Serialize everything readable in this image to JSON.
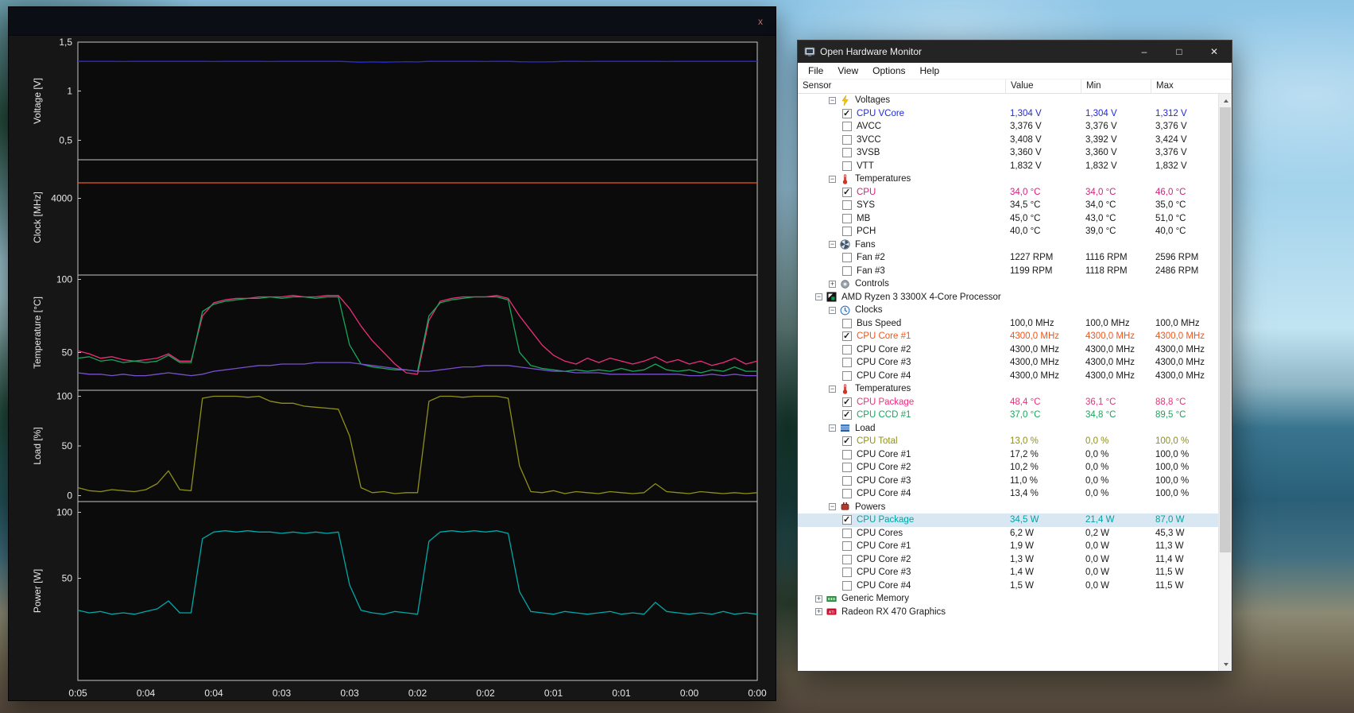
{
  "plot_window": {
    "close_label": "x",
    "x_axis": {
      "labels": [
        "0:05",
        "0:04",
        "0:04",
        "0:03",
        "0:03",
        "0:02",
        "0:02",
        "0:01",
        "0:01",
        "0:00",
        "0:00"
      ],
      "duration_s": 300,
      "step_s": 5
    },
    "colors": {
      "background": "#161616",
      "panel": "#0b0b0b",
      "border": "#c6c6c6",
      "text": "#e8e8e8"
    }
  },
  "chart_data": [
    {
      "type": "line",
      "ylabel": "Voltage [V]",
      "ymin": 0.3,
      "ymax": 1.5,
      "yticks": [
        {
          "value": 1.5,
          "label": "1,5"
        },
        {
          "value": 1.0,
          "label": "1"
        },
        {
          "value": 0.5,
          "label": "0,5"
        }
      ],
      "series": [
        {
          "name": "CPU VCore",
          "color": "#2a2ae0",
          "values": [
            1.304,
            1.304,
            1.304,
            1.304,
            1.302,
            1.304,
            1.304,
            1.304,
            1.304,
            1.304,
            1.304,
            1.304,
            1.302,
            1.304,
            1.304,
            1.304,
            1.304,
            1.302,
            1.304,
            1.304,
            1.304,
            1.304,
            1.304,
            1.304,
            1.3,
            1.296,
            1.298,
            1.296,
            1.298,
            1.3,
            1.298,
            1.304,
            1.304,
            1.304,
            1.304,
            1.304,
            1.302,
            1.304,
            1.304,
            1.3,
            1.298,
            1.298,
            1.3,
            1.304,
            1.304,
            1.302,
            1.304,
            1.304,
            1.304,
            1.304,
            1.304,
            1.304,
            1.302,
            1.304,
            1.304,
            1.304,
            1.304,
            1.304,
            1.304,
            1.304,
            1.304
          ]
        }
      ]
    },
    {
      "type": "line",
      "ylabel": "Clock [MHz]",
      "ymin": 2500,
      "ymax": 4750,
      "yticks": [
        {
          "value": 4000,
          "label": "4000"
        }
      ],
      "series": [
        {
          "name": "CPU Core #1",
          "color": "#f0561c",
          "step_s": 300,
          "values": [
            4300,
            4300
          ]
        }
      ]
    },
    {
      "type": "line",
      "ylabel": "Temperature [°C]",
      "ymin": 24,
      "ymax": 103,
      "yticks": [
        {
          "value": 100,
          "label": "100"
        },
        {
          "value": 50,
          "label": "50"
        }
      ],
      "series": [
        {
          "name": "CPU Package",
          "color": "#ee2e7b",
          "values": [
            51,
            49,
            46,
            47,
            45,
            44,
            45,
            46,
            49,
            44,
            44,
            75,
            84,
            86,
            87,
            87,
            88,
            88,
            88,
            89,
            88,
            88,
            89,
            89,
            80,
            68,
            58,
            50,
            42,
            36,
            35,
            72,
            85,
            87,
            88,
            88,
            88,
            89,
            87,
            75,
            65,
            55,
            48,
            44,
            42,
            46,
            43,
            46,
            44,
            42,
            44,
            47,
            43,
            45,
            42,
            44,
            41,
            43,
            46,
            42,
            44
          ]
        },
        {
          "name": "CPU CCD #1",
          "color": "#16a75c",
          "values": [
            46,
            47,
            44,
            45,
            43,
            44,
            43,
            44,
            48,
            43,
            43,
            78,
            83,
            85,
            86,
            87,
            87,
            88,
            87,
            88,
            88,
            87,
            88,
            88,
            55,
            42,
            40,
            39,
            38,
            38,
            37,
            75,
            84,
            86,
            87,
            88,
            88,
            88,
            86,
            50,
            41,
            39,
            38,
            37,
            38,
            37,
            38,
            37,
            39,
            37,
            38,
            42,
            38,
            37,
            38,
            36,
            38,
            37,
            40,
            37,
            37
          ]
        },
        {
          "name": "CPU",
          "color": "#7a4fd0",
          "values": [
            36,
            35,
            35,
            34,
            35,
            34,
            34,
            35,
            36,
            35,
            34,
            35,
            37,
            38,
            39,
            40,
            41,
            41,
            42,
            42,
            42,
            43,
            43,
            43,
            43,
            42,
            41,
            40,
            39,
            38,
            37,
            37,
            38,
            39,
            40,
            40,
            41,
            41,
            41,
            40,
            39,
            38,
            37,
            37,
            36,
            36,
            36,
            35,
            35,
            35,
            35,
            35,
            35,
            35,
            34,
            34,
            35,
            34,
            35,
            34,
            34
          ]
        }
      ]
    },
    {
      "type": "line",
      "ylabel": "Load [%]",
      "ymin": -6,
      "ymax": 106,
      "yticks": [
        {
          "value": 100,
          "label": "100"
        },
        {
          "value": 50,
          "label": "50"
        },
        {
          "value": 0,
          "label": "0"
        }
      ],
      "series": [
        {
          "name": "CPU Total",
          "color": "#8f8f1a",
          "values": [
            8,
            5,
            4,
            6,
            5,
            4,
            6,
            12,
            25,
            6,
            5,
            98,
            100,
            100,
            100,
            99,
            100,
            95,
            93,
            93,
            90,
            89,
            88,
            87,
            60,
            8,
            3,
            4,
            2,
            3,
            3,
            95,
            100,
            100,
            99,
            100,
            100,
            100,
            98,
            30,
            4,
            3,
            5,
            2,
            4,
            3,
            2,
            4,
            3,
            2,
            3,
            12,
            4,
            3,
            2,
            4,
            3,
            2,
            3,
            2,
            3
          ]
        }
      ]
    },
    {
      "type": "line",
      "ylabel": "Power [W]",
      "ymin": -27,
      "ymax": 108,
      "yticks": [
        {
          "value": 100,
          "label": "100"
        },
        {
          "value": 50,
          "label": "50"
        }
      ],
      "series": [
        {
          "name": "CPU Package",
          "color": "#00a8a8",
          "values": [
            26,
            24,
            25,
            23,
            24,
            23,
            25,
            27,
            33,
            24,
            24,
            80,
            85,
            86,
            85,
            86,
            85,
            85,
            84,
            85,
            84,
            85,
            84,
            85,
            45,
            26,
            24,
            23,
            25,
            24,
            23,
            78,
            85,
            86,
            85,
            86,
            85,
            86,
            84,
            40,
            25,
            24,
            23,
            25,
            24,
            23,
            24,
            25,
            23,
            24,
            23,
            32,
            25,
            24,
            23,
            24,
            23,
            25,
            23,
            24,
            23
          ]
        }
      ]
    }
  ],
  "monitor_window": {
    "title": "Open Hardware Monitor",
    "window_buttons": {
      "minimize": "–",
      "maximize": "□",
      "close": "✕"
    },
    "menu": [
      "File",
      "View",
      "Options",
      "Help"
    ],
    "columns": [
      "Sensor",
      "Value",
      "Min",
      "Max"
    ],
    "rows": [
      {
        "kind": "group",
        "level": 2,
        "expand": "minus",
        "icon": "bolt",
        "label": "Voltages"
      },
      {
        "kind": "sensor",
        "level": 3,
        "checked": true,
        "color": "#1f2bd6",
        "label": "CPU VCore",
        "value": "1,304 V",
        "min": "1,304 V",
        "max": "1,312 V"
      },
      {
        "kind": "sensor",
        "level": 3,
        "checked": false,
        "label": "AVCC",
        "value": "3,376 V",
        "min": "3,376 V",
        "max": "3,376 V"
      },
      {
        "kind": "sensor",
        "level": 3,
        "checked": false,
        "label": "3VCC",
        "value": "3,408 V",
        "min": "3,392 V",
        "max": "3,424 V"
      },
      {
        "kind": "sensor",
        "level": 3,
        "checked": false,
        "label": "3VSB",
        "value": "3,360 V",
        "min": "3,360 V",
        "max": "3,376 V"
      },
      {
        "kind": "sensor",
        "level": 3,
        "checked": false,
        "label": "VTT",
        "value": "1,832 V",
        "min": "1,832 V",
        "max": "1,832 V"
      },
      {
        "kind": "group",
        "level": 2,
        "expand": "minus",
        "icon": "thermometer",
        "label": "Temperatures"
      },
      {
        "kind": "sensor",
        "level": 3,
        "checked": true,
        "color": "#d4217e",
        "label": "CPU",
        "value": "34,0 °C",
        "min": "34,0 °C",
        "max": "46,0 °C"
      },
      {
        "kind": "sensor",
        "level": 3,
        "checked": false,
        "label": "SYS",
        "value": "34,5 °C",
        "min": "34,0 °C",
        "max": "35,0 °C"
      },
      {
        "kind": "sensor",
        "level": 3,
        "checked": false,
        "label": "MB",
        "value": "45,0 °C",
        "min": "43,0 °C",
        "max": "51,0 °C"
      },
      {
        "kind": "sensor",
        "level": 3,
        "checked": false,
        "label": "PCH",
        "value": "40,0 °C",
        "min": "39,0 °C",
        "max": "40,0 °C"
      },
      {
        "kind": "group",
        "level": 2,
        "expand": "minus",
        "icon": "fan",
        "label": "Fans"
      },
      {
        "kind": "sensor",
        "level": 3,
        "checked": false,
        "label": "Fan #2",
        "value": "1227 RPM",
        "min": "1116 RPM",
        "max": "2596 RPM"
      },
      {
        "kind": "sensor",
        "level": 3,
        "checked": false,
        "label": "Fan #3",
        "value": "1199 RPM",
        "min": "1118 RPM",
        "max": "2486 RPM"
      },
      {
        "kind": "group",
        "level": 2,
        "expand": "plus",
        "icon": "gear",
        "label": "Controls"
      },
      {
        "kind": "hardware",
        "level": 1,
        "expand": "minus",
        "icon": "amd-chip",
        "label": "AMD Ryzen 3 3300X 4-Core Processor"
      },
      {
        "kind": "group",
        "level": 2,
        "expand": "minus",
        "icon": "clock",
        "label": "Clocks"
      },
      {
        "kind": "sensor",
        "level": 3,
        "checked": false,
        "label": "Bus Speed",
        "value": "100,0 MHz",
        "min": "100,0 MHz",
        "max": "100,0 MHz"
      },
      {
        "kind": "sensor",
        "level": 3,
        "checked": true,
        "color": "#f0561c",
        "label": "CPU Core #1",
        "value": "4300,0 MHz",
        "min": "4300,0 MHz",
        "max": "4300,0 MHz"
      },
      {
        "kind": "sensor",
        "level": 3,
        "checked": false,
        "label": "CPU Core #2",
        "value": "4300,0 MHz",
        "min": "4300,0 MHz",
        "max": "4300,0 MHz"
      },
      {
        "kind": "sensor",
        "level": 3,
        "checked": false,
        "label": "CPU Core #3",
        "value": "4300,0 MHz",
        "min": "4300,0 MHz",
        "max": "4300,0 MHz"
      },
      {
        "kind": "sensor",
        "level": 3,
        "checked": false,
        "label": "CPU Core #4",
        "value": "4300,0 MHz",
        "min": "4300,0 MHz",
        "max": "4300,0 MHz"
      },
      {
        "kind": "group",
        "level": 2,
        "expand": "minus",
        "icon": "thermometer",
        "label": "Temperatures"
      },
      {
        "kind": "sensor",
        "level": 3,
        "checked": true,
        "color": "#ee2e7b",
        "label": "CPU Package",
        "value": "48,4 °C",
        "min": "36,1 °C",
        "max": "88,8 °C"
      },
      {
        "kind": "sensor",
        "level": 3,
        "checked": true,
        "color": "#16a75c",
        "label": "CPU CCD #1",
        "value": "37,0 °C",
        "min": "34,8 °C",
        "max": "89,5 °C"
      },
      {
        "kind": "group",
        "level": 2,
        "expand": "minus",
        "icon": "load-bars",
        "label": "Load"
      },
      {
        "kind": "sensor",
        "level": 3,
        "checked": true,
        "color": "#8f8f1a",
        "label": "CPU Total",
        "value": "13,0 %",
        "min": "0,0 %",
        "max": "100,0 %"
      },
      {
        "kind": "sensor",
        "level": 3,
        "checked": false,
        "label": "CPU Core #1",
        "value": "17,2 %",
        "min": "0,0 %",
        "max": "100,0 %"
      },
      {
        "kind": "sensor",
        "level": 3,
        "checked": false,
        "label": "CPU Core #2",
        "value": "10,2 %",
        "min": "0,0 %",
        "max": "100,0 %"
      },
      {
        "kind": "sensor",
        "level": 3,
        "checked": false,
        "label": "CPU Core #3",
        "value": "11,0 %",
        "min": "0,0 %",
        "max": "100,0 %"
      },
      {
        "kind": "sensor",
        "level": 3,
        "checked": false,
        "label": "CPU Core #4",
        "value": "13,4 %",
        "min": "0,0 %",
        "max": "100,0 %"
      },
      {
        "kind": "group",
        "level": 2,
        "expand": "minus",
        "icon": "power-plug",
        "label": "Powers"
      },
      {
        "kind": "sensor",
        "level": 3,
        "checked": true,
        "selected": true,
        "color": "#00a3a3",
        "label": "CPU Package",
        "value": "34,5 W",
        "min": "21,4 W",
        "max": "87,0 W"
      },
      {
        "kind": "sensor",
        "level": 3,
        "checked": false,
        "label": "CPU Cores",
        "value": "6,2 W",
        "min": "0,2 W",
        "max": "45,3 W"
      },
      {
        "kind": "sensor",
        "level": 3,
        "checked": false,
        "label": "CPU Core #1",
        "value": "1,9 W",
        "min": "0,0 W",
        "max": "11,3 W"
      },
      {
        "kind": "sensor",
        "level": 3,
        "checked": false,
        "label": "CPU Core #2",
        "value": "1,3 W",
        "min": "0,0 W",
        "max": "11,4 W"
      },
      {
        "kind": "sensor",
        "level": 3,
        "checked": false,
        "label": "CPU Core #3",
        "value": "1,4 W",
        "min": "0,0 W",
        "max": "11,5 W"
      },
      {
        "kind": "sensor",
        "level": 3,
        "checked": false,
        "label": "CPU Core #4",
        "value": "1,5 W",
        "min": "0,0 W",
        "max": "11,5 W"
      },
      {
        "kind": "hardware",
        "level": 1,
        "expand": "plus",
        "icon": "memory",
        "label": "Generic Memory"
      },
      {
        "kind": "hardware",
        "level": 1,
        "expand": "plus",
        "icon": "ati-gpu",
        "label": "Radeon RX 470 Graphics"
      }
    ]
  }
}
